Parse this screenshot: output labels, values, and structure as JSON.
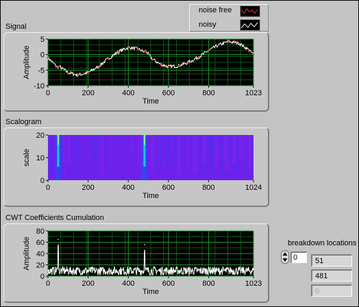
{
  "legend": {
    "items": [
      {
        "label": "noise free",
        "color": "#ff3030"
      },
      {
        "label": "noisy",
        "color": "#ffffff"
      }
    ]
  },
  "signal": {
    "title": "Signal",
    "chart_data": {
      "type": "line",
      "title": "Signal",
      "xlabel": "Time",
      "ylabel": "Amplitude",
      "xlim": [
        0,
        1023
      ],
      "ylim": [
        -10,
        5
      ],
      "xticks": [
        "0",
        "200",
        "400",
        "600",
        "800",
        "1023"
      ],
      "yticks": [
        "5",
        "0",
        "-5",
        "-10"
      ],
      "grid": true,
      "series": [
        {
          "name": "noise free",
          "color": "#ff3030",
          "x": [
            0,
            50,
            55,
            100,
            150,
            200,
            250,
            300,
            350,
            400,
            450,
            480,
            485,
            520,
            560,
            600,
            650,
            700,
            750,
            800,
            850,
            900,
            950,
            1000,
            1023
          ],
          "y": [
            -1,
            -4.3,
            -3.8,
            -5.8,
            -6.6,
            -5.8,
            -3.9,
            -1.3,
            0.9,
            2.3,
            1.8,
            0.8,
            1.3,
            -1.5,
            -3.1,
            -3.9,
            -3.6,
            -2.5,
            -0.8,
            1.3,
            3.1,
            4.2,
            3.7,
            1.5,
            0
          ]
        },
        {
          "name": "noisy",
          "color": "#ffffff"
        }
      ]
    }
  },
  "scalogram": {
    "title": "Scalogram",
    "chart_data": {
      "type": "heatmap",
      "title": "Scalogram",
      "xlabel": "Time",
      "ylabel": "scale",
      "xlim": [
        0,
        1024
      ],
      "ylim": [
        0,
        20
      ],
      "xticks": [
        "0",
        "200",
        "400",
        "600",
        "800",
        "1024"
      ],
      "yticks": [
        "20",
        "10",
        "0"
      ],
      "breakdown_spikes_x": [
        51,
        481
      ]
    }
  },
  "cwt": {
    "title": "CWT Coefficients Cumulation",
    "chart_data": {
      "type": "line",
      "title": "CWT Coefficients Cumulation",
      "xlabel": "Time",
      "ylabel": "Amplitude",
      "xlim": [
        0,
        1023
      ],
      "ylim": [
        0,
        80
      ],
      "xticks": [
        "0",
        "200",
        "400",
        "600",
        "800",
        "1023"
      ],
      "yticks": [
        "80",
        "60",
        "40",
        "20",
        "0"
      ],
      "grid": true,
      "series": [
        {
          "name": "",
          "color": "#ffffff",
          "x": [
            0,
            51,
            100,
            200,
            300,
            400,
            481,
            500,
            600,
            700,
            800,
            900,
            1023
          ],
          "y": [
            10,
            65,
            8,
            10,
            9,
            11,
            56,
            9,
            10,
            9,
            14,
            10,
            12
          ]
        }
      ]
    }
  },
  "breakdown": {
    "label": "breakdown locations",
    "index": "0",
    "values": [
      "51",
      "481",
      "0"
    ]
  }
}
